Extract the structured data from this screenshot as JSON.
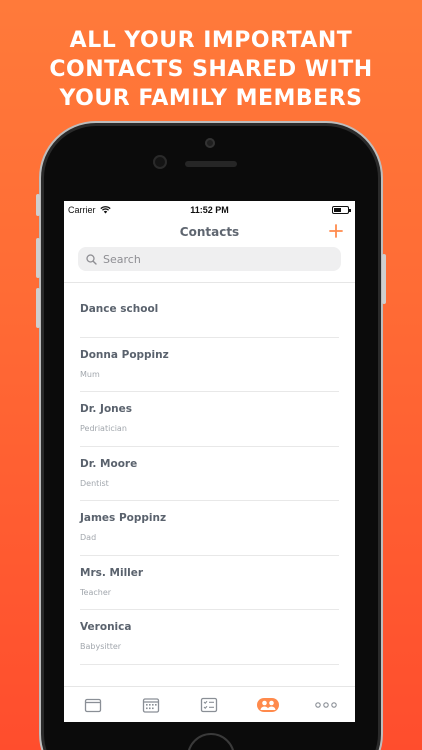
{
  "promo": {
    "line1": "ALL YOUR IMPORTANT",
    "line2": "CONTACTS SHARED WITH",
    "line3": "YOUR FAMILY MEMBERS"
  },
  "status": {
    "carrier": "Carrier",
    "time": "11:52 PM"
  },
  "nav": {
    "title": "Contacts"
  },
  "search": {
    "placeholder": "Search"
  },
  "contacts": [
    {
      "name": "Dance school",
      "role": ""
    },
    {
      "name": "Donna Poppinz",
      "role": "Mum"
    },
    {
      "name": "Dr. Jones",
      "role": "Pedriatician"
    },
    {
      "name": "Dr. Moore",
      "role": "Dentist"
    },
    {
      "name": "James Poppinz",
      "role": "Dad"
    },
    {
      "name": "Mrs. Miller",
      "role": "Teacher"
    },
    {
      "name": "Veronica",
      "role": "Babysitter"
    }
  ],
  "tabs": [
    {
      "icon": "calendar-card-icon",
      "active": false
    },
    {
      "icon": "calendar-grid-icon",
      "active": false
    },
    {
      "icon": "checklist-icon",
      "active": false
    },
    {
      "icon": "contacts-icon",
      "active": true
    },
    {
      "icon": "more-dots-icon",
      "active": false
    }
  ],
  "colors": {
    "accent": "#ff8a4c",
    "background_top": "#ff7a3a",
    "background_bottom": "#ff4d2d",
    "tab_inactive": "#8a8f96"
  }
}
